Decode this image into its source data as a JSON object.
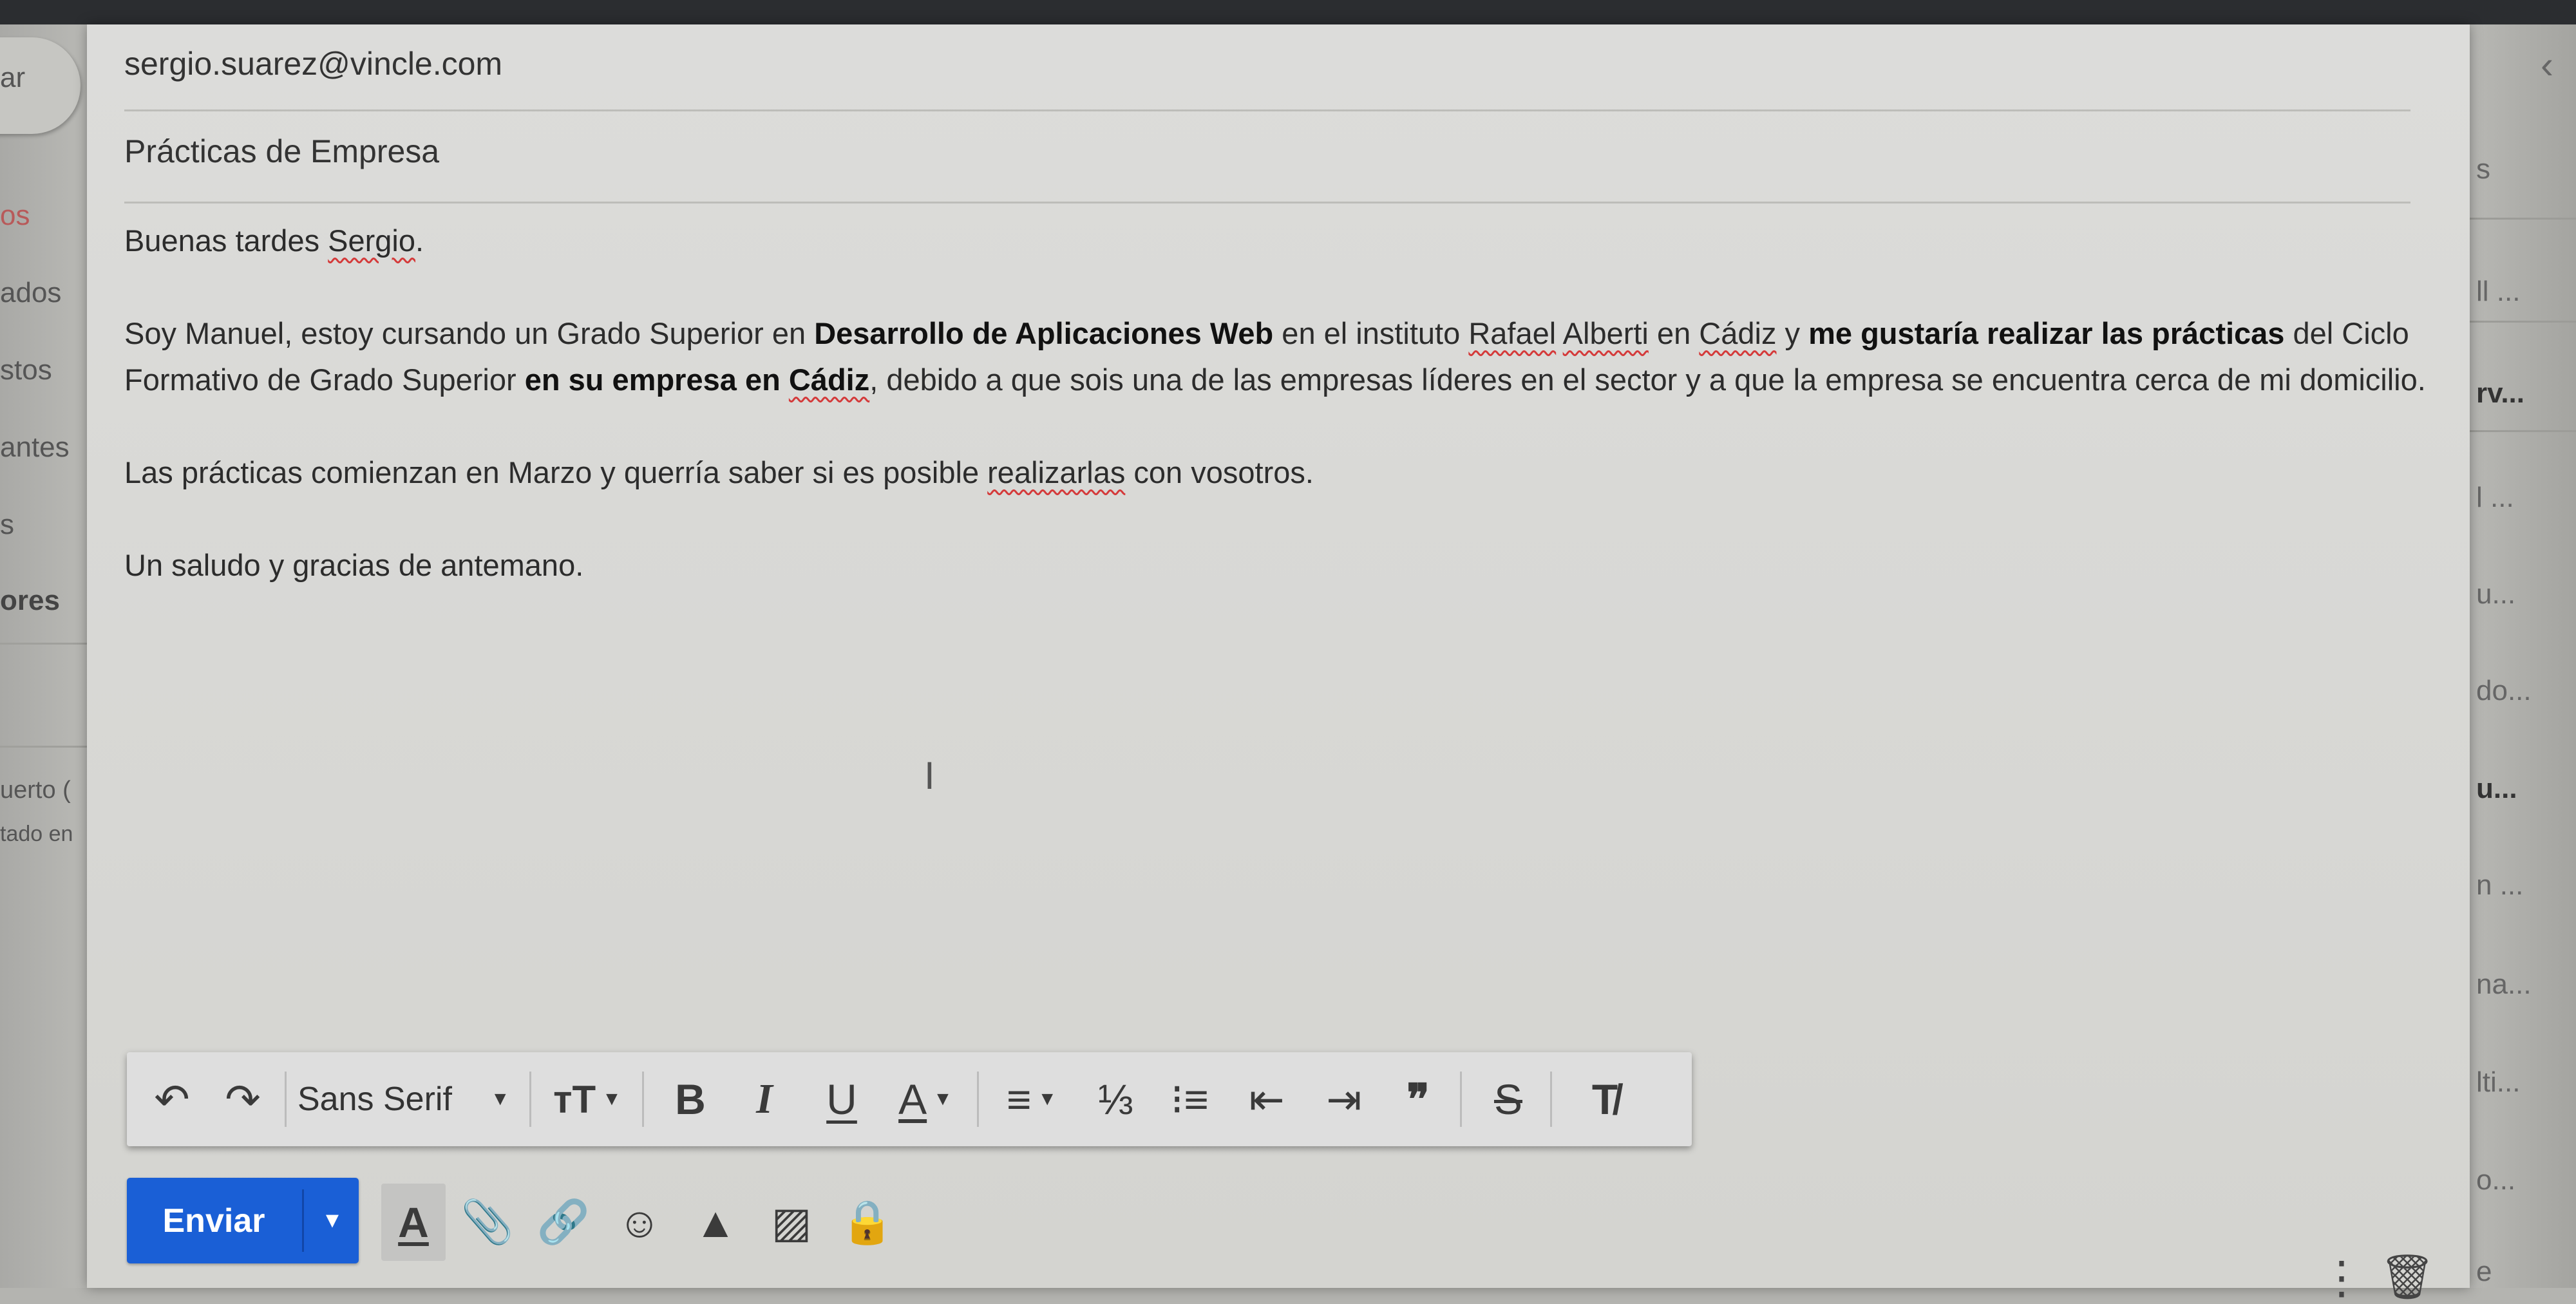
{
  "compose": {
    "to": "sergio.suarez@vincle.com",
    "subject": "Prácticas de Empresa",
    "body": {
      "greeting_a": "Buenas tardes ",
      "greeting_name": "Sergio",
      "greeting_c": ".",
      "p1": {
        "t1": "Soy Manuel, estoy cursando un Grado Superior en ",
        "b1": "Desarrollo de Aplicaciones Web",
        "t2": " en el instituto ",
        "sp1": "Rafael",
        "t3": " ",
        "sp2": "Alberti",
        "t4": " en ",
        "sp3": "Cádiz",
        "t5": " y ",
        "b2": "me gustaría realizar las prácticas",
        "t6": " del Ciclo Formativo de Grado Superior ",
        "b3": "en su empresa en ",
        "b3sp": "Cádiz",
        "t7": ", debido a que sois una de las empresas líderes en el sector y a que la empresa se encuentra cerca de mi domicilio."
      },
      "p2": {
        "t1": "Las prácticas comienzan en Marzo y querría saber si es posible ",
        "sp": "realizarlas",
        "t2": " con vosotros."
      },
      "p3": "Un saludo y gracias de antemano."
    }
  },
  "toolbar": {
    "undo": "↶",
    "redo": "↷",
    "font": "Sans Serif",
    "dropdown": "▼",
    "size": "тT",
    "bold": "B",
    "italic": "I",
    "underline": "U",
    "text_color": "A",
    "align": "≡",
    "numbered_list": "⅓",
    "bullet_list": "⁝≡",
    "indent_less": "⇤",
    "indent_more": "⇥",
    "quote": "❞",
    "strike": "S",
    "clear": "T̸"
  },
  "actions": {
    "send": "Enviar",
    "send_more": "▼",
    "formatting": "A",
    "attach": "📎",
    "link": "🔗",
    "emoji": "☺",
    "drive": "▲",
    "photo": "▨",
    "confidential": "🔒",
    "more": "⋮",
    "discard": "🗑"
  },
  "left_pane": {
    "items": [
      "ar",
      "os",
      "ados",
      "stos",
      "antes",
      "s",
      "ores",
      "uerto (",
      "tado en"
    ]
  },
  "right_pane": {
    "items": [
      "s",
      "ll ...",
      "rv...",
      "l ...",
      "u...",
      "do...",
      "u...",
      "n ...",
      "na...",
      "lti...",
      "o...",
      "e"
    ],
    "chevron": "‹"
  }
}
